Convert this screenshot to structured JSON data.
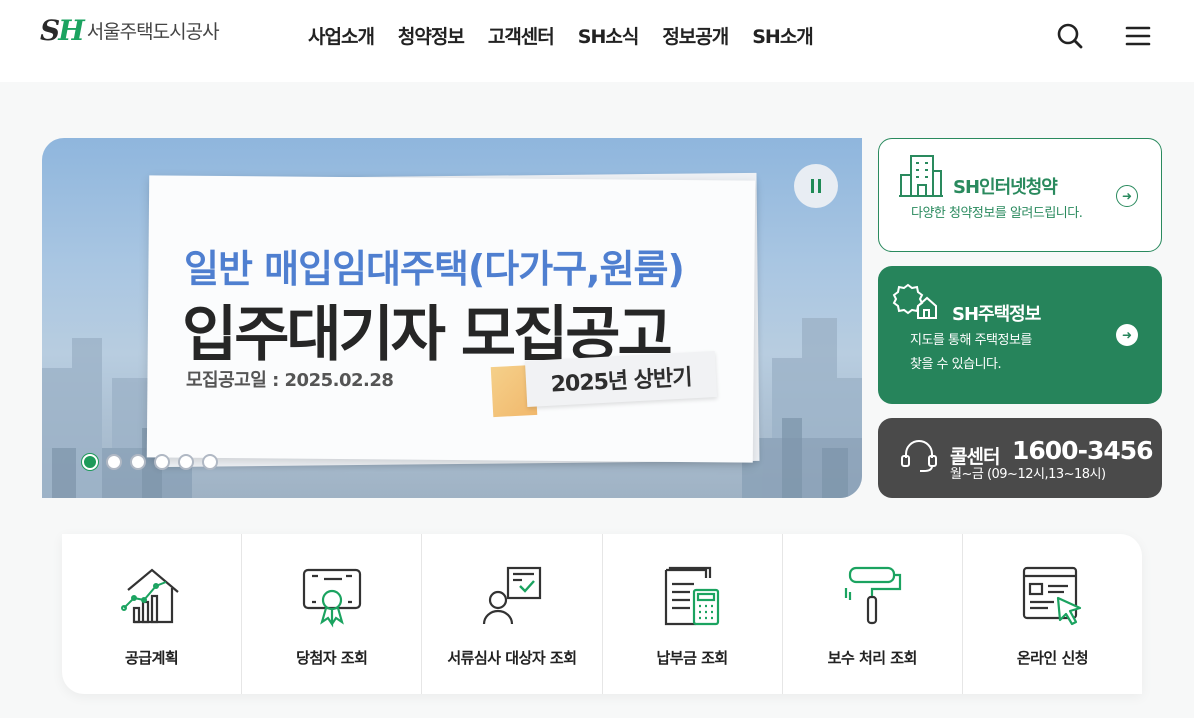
{
  "header": {
    "logo_mark_s": "S",
    "logo_mark_h": "H",
    "logo_text": "서울주택도시공사",
    "nav": [
      "사업소개",
      "청약정보",
      "고객센터",
      "SH소식",
      "정보공개",
      "SH소개"
    ]
  },
  "banner": {
    "subtitle": "일반 매입임대주택(다가구,원룸)",
    "title": "입주대기자 모집공고",
    "date": "모집공고일 : 2025.02.28",
    "badge": "2025년 상반기",
    "slide_count": 6,
    "active_slide": 1
  },
  "panels": {
    "apply": {
      "title": "SH인터넷청약",
      "desc": "다양한 청약정보를 알려드립니다."
    },
    "housing": {
      "title": "SH주택정보",
      "desc_line1": "지도를 통해 주택정보를",
      "desc_line2": "찾을 수 있습니다."
    },
    "call": {
      "title": "콜센터",
      "number": "1600-3456",
      "hours": "월~금 (09~12시,13~18시)"
    }
  },
  "quick_menu": [
    {
      "label": "공급계획",
      "icon": "house-chart-icon"
    },
    {
      "label": "당첨자 조회",
      "icon": "certificate-icon"
    },
    {
      "label": "서류심사 대상자 조회",
      "icon": "person-document-icon"
    },
    {
      "label": "납부금 조회",
      "icon": "calculator-icon"
    },
    {
      "label": "보수 처리 조회",
      "icon": "paint-roller-icon"
    },
    {
      "label": "온라인 신청",
      "icon": "online-form-icon"
    }
  ],
  "colors": {
    "brand_green": "#26845b",
    "accent_green": "#1ba360",
    "banner_blue": "#4f7fd0",
    "dark_panel": "#4a4a4a"
  }
}
